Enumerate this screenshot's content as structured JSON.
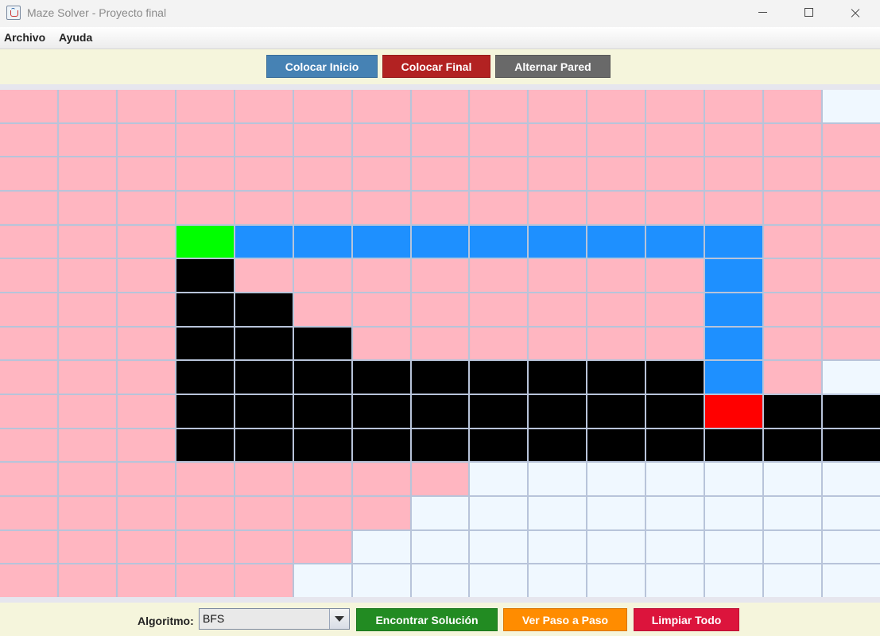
{
  "window": {
    "title": "Maze Solver - Proyecto final",
    "app_icon": "java-icon"
  },
  "menu": [
    "Archivo",
    "Ayuda"
  ],
  "toolbar": {
    "buttons": [
      {
        "label": "Colocar Inicio",
        "color": "#4682b4"
      },
      {
        "label": "Colocar Final",
        "color": "#b22222"
      },
      {
        "label": "Alternar Pared",
        "color": "#696969"
      }
    ]
  },
  "maze": {
    "rows": 15,
    "cols": 15,
    "legend": {
      "X": {
        "meaning": "wall",
        "color": "#000000"
      },
      "P": {
        "meaning": "explored",
        "color": "#ffb6c1"
      },
      "E": {
        "meaning": "empty",
        "color": "#f0f8ff"
      },
      "S": {
        "meaning": "start",
        "color": "#00ff00"
      },
      "G": {
        "meaning": "goal",
        "color": "#ff0000"
      },
      "B": {
        "meaning": "path",
        "color": "#1e90ff"
      }
    },
    "grid": [
      "PPPPPPPPPPPPPPE",
      "PPPPPPPPPPPPPPP",
      "PPPPPPPPPPPPPPP",
      "PPPPPPPPPPPPPPP",
      "PPPSBBBBBBBBBPP",
      "PPPXPPPPPPPPBPP",
      "PPPXXPPPPPPPBPP",
      "PPPXXXPPPPPPBPP",
      "PPPXXXXXXXXXBPE",
      "PPPXXXXXXXXXGXX",
      "PPPXXXXXXXXXXXX",
      "PPPPPPPPEEEEEEE",
      "PPPPPPPEEEEEEEE",
      "PPPPPPEEEEEEEEE",
      "PPPPPEEEEEEEEEE"
    ]
  },
  "bottom_bar": {
    "algorithm_label": "Algoritmo:",
    "algorithm_value": "BFS",
    "buttons": [
      {
        "label": "Encontrar Solución",
        "color": "#228b22"
      },
      {
        "label": "Ver Paso a Paso",
        "color": "#ff8c00"
      },
      {
        "label": "Limpiar Todo",
        "color": "#dc143c"
      }
    ]
  }
}
